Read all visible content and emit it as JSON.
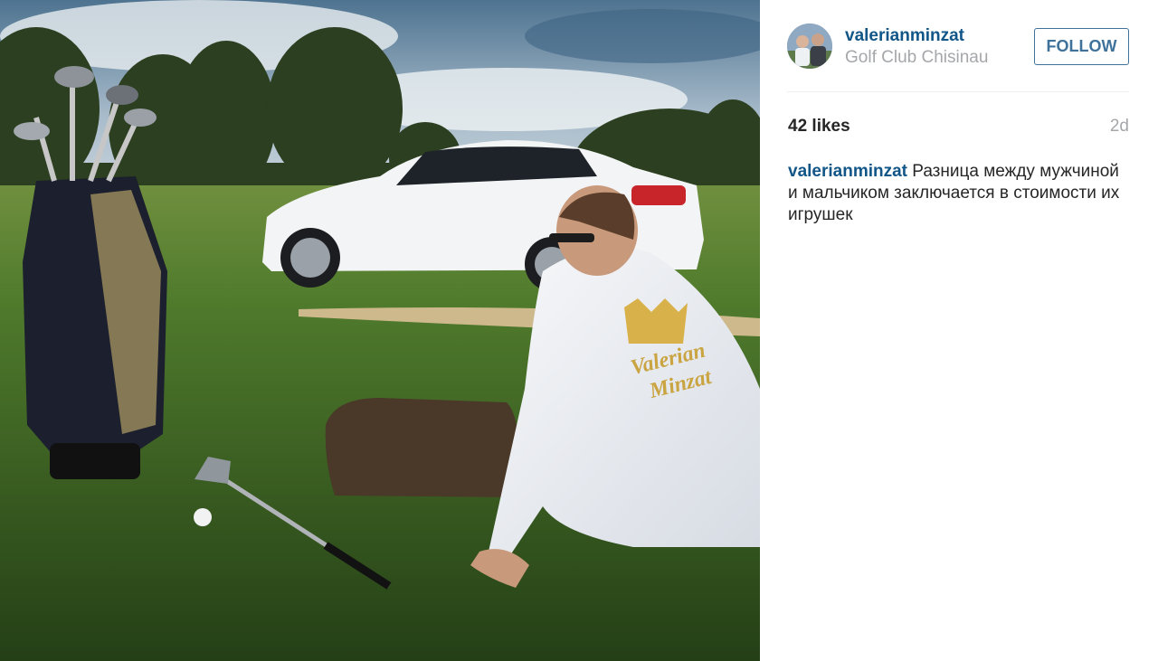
{
  "post": {
    "photo_alt_icon": "golf-course-photo",
    "author": {
      "username": "valerianminzat",
      "location": "Golf Club Chisinau"
    },
    "follow_label": "FOLLOW",
    "likes": "42 likes",
    "time_ago": "2d",
    "caption": {
      "username": "valerianminzat",
      "text": "Разница между мужчиной и мальчиком заключается в стоимости их игрушек"
    },
    "robe_text": {
      "line1": "Valerian",
      "line2": "Minzat"
    }
  },
  "colors": {
    "link": "#125688",
    "follow_border": "#3f729b",
    "muted": "#a5a7aa"
  }
}
